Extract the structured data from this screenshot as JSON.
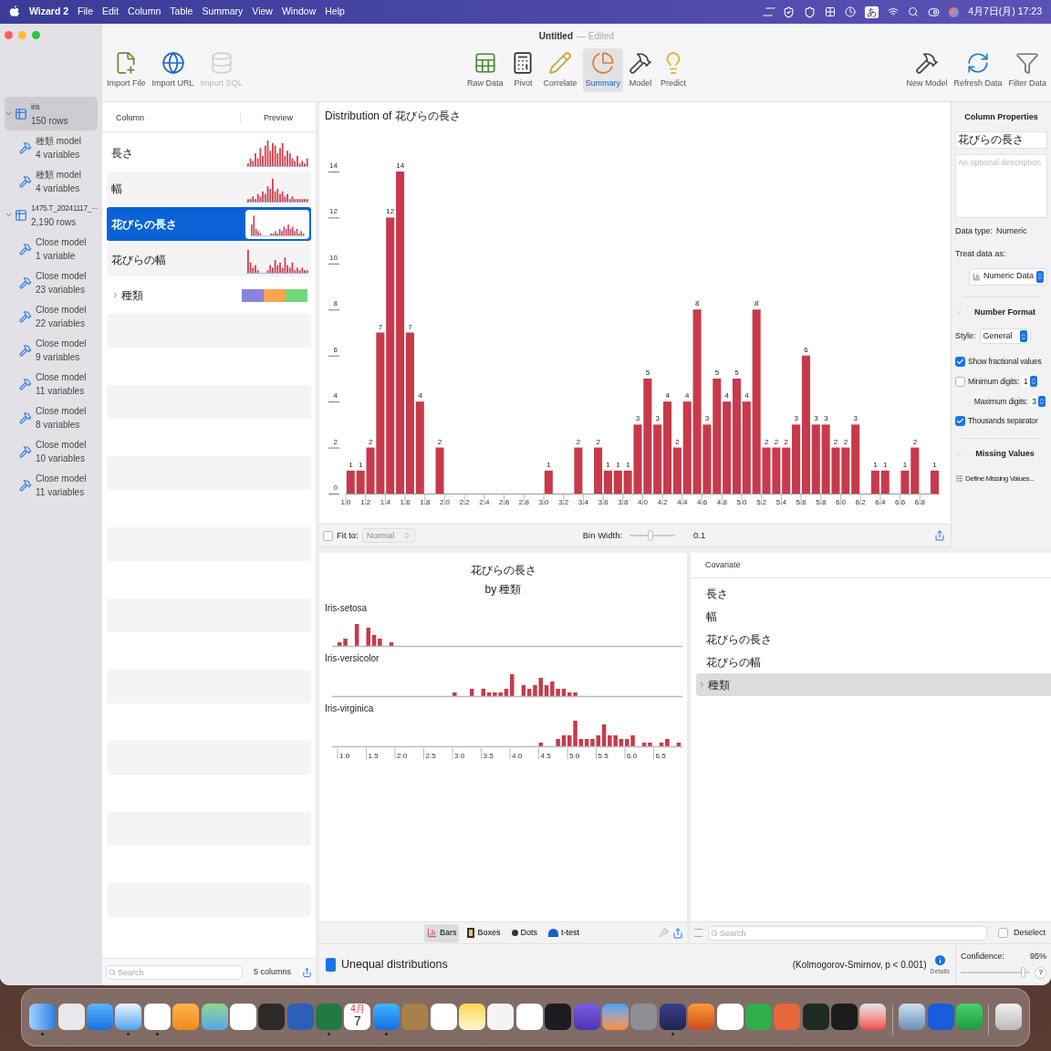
{
  "menu_bar": {
    "app": "Wizard 2",
    "menus": [
      "File",
      "Edit",
      "Column",
      "Table",
      "Summary",
      "View",
      "Window",
      "Help"
    ],
    "input_mode": "あ",
    "clock": "4月7日(月) 17:23"
  },
  "window": {
    "title": "Untitled",
    "status": "— Edited"
  },
  "toolbar": {
    "left": [
      {
        "label": "Import File",
        "kind": "file",
        "disabled": false
      },
      {
        "label": "Import URL",
        "kind": "globe",
        "disabled": false
      },
      {
        "label": "Import SQL",
        "kind": "database",
        "disabled": true
      }
    ],
    "center": [
      {
        "label": "Raw Data",
        "kind": "table",
        "selected": false
      },
      {
        "label": "Pivot",
        "kind": "calculator",
        "selected": false
      },
      {
        "label": "Correlate",
        "kind": "pencil",
        "selected": false
      },
      {
        "label": "Summary",
        "kind": "pie",
        "selected": true
      },
      {
        "label": "Model",
        "kind": "hammer",
        "selected": false
      },
      {
        "label": "Predict",
        "kind": "bulb",
        "selected": false
      }
    ],
    "right": [
      {
        "label": "New Model",
        "kind": "hammer",
        "disabled": false
      },
      {
        "label": "Refresh Data",
        "kind": "refresh",
        "disabled": false
      },
      {
        "label": "Filter Data",
        "kind": "funnel",
        "disabled": false
      }
    ]
  },
  "sidebar": {
    "datasets": [
      {
        "name": "iris",
        "rows": "150 rows",
        "selected": true,
        "expanded": true,
        "children": [
          {
            "name": "種類 model",
            "detail": "4 variables",
            "selected": false
          },
          {
            "name": "種類 model",
            "detail": "4 variables",
            "selected": false
          }
        ]
      },
      {
        "name": "1475.T_20241117_···",
        "rows": "2,190 rows",
        "selected": false,
        "expanded": true,
        "children": [
          {
            "name": "Close model",
            "detail": "1 variable",
            "selected": false
          },
          {
            "name": "Close model",
            "detail": "23 variables",
            "selected": false
          },
          {
            "name": "Close model",
            "detail": "22 variables",
            "selected": false
          },
          {
            "name": "Close model",
            "detail": "9 variables",
            "selected": false
          },
          {
            "name": "Close model",
            "detail": "11 variables",
            "selected": false
          },
          {
            "name": "Close model",
            "detail": "8 variables",
            "selected": false
          },
          {
            "name": "Close model",
            "detail": "10 variables",
            "selected": false
          },
          {
            "name": "Close model",
            "detail": "11 variables",
            "selected": false
          }
        ]
      }
    ]
  },
  "columns": {
    "header": [
      "Column",
      "Preview"
    ],
    "rows": [
      {
        "name": "長さ",
        "kind": "numeric",
        "selected": false
      },
      {
        "name": "幅",
        "kind": "numeric",
        "selected": false
      },
      {
        "name": "花びらの長さ",
        "kind": "numeric",
        "selected": true
      },
      {
        "name": "花びらの幅",
        "kind": "numeric",
        "selected": false
      },
      {
        "name": "種類",
        "kind": "category",
        "selected": false,
        "expanded": false,
        "segments": [
          {
            "color": "#8a83e0"
          },
          {
            "color": "#f7a64e"
          },
          {
            "color": "#72d77a"
          }
        ]
      }
    ],
    "search_placeholder": "Search",
    "count": "5 columns"
  },
  "distribution": {
    "chart_data": {
      "type": "bar",
      "title": "Distribution of 花びらの長さ",
      "x": [
        1.05,
        1.15,
        1.25,
        1.35,
        1.45,
        1.55,
        1.65,
        1.75,
        1.95,
        3.05,
        3.35,
        3.55,
        3.65,
        3.75,
        3.85,
        3.95,
        4.05,
        4.15,
        4.25,
        4.35,
        4.45,
        4.55,
        4.65,
        4.75,
        4.85,
        4.95,
        5.05,
        5.15,
        5.25,
        5.35,
        5.45,
        5.55,
        5.65,
        5.75,
        5.85,
        5.95,
        6.05,
        6.15,
        6.35,
        6.45,
        6.65,
        6.75,
        6.95
      ],
      "xlim": [
        1.0,
        7.0
      ],
      "values": [
        1,
        1,
        2,
        7,
        12,
        14,
        7,
        4,
        2,
        1,
        2,
        2,
        1,
        1,
        1,
        3,
        5,
        3,
        4,
        2,
        4,
        8,
        3,
        5,
        4,
        5,
        4,
        8,
        2,
        2,
        2,
        3,
        6,
        3,
        3,
        2,
        2,
        3,
        1,
        1,
        1,
        2,
        1
      ],
      "xticks": [
        {
          "value": 1.0,
          "label": "1.0"
        },
        {
          "value": 1.2,
          "label": "1.2"
        },
        {
          "value": 1.4,
          "label": "1.4"
        },
        {
          "value": 1.6,
          "label": "1.6"
        },
        {
          "value": 1.8,
          "label": "1.8"
        },
        {
          "value": 2.0,
          "label": "2.0"
        },
        {
          "value": 2.2,
          "label": "2.2"
        },
        {
          "value": 2.4,
          "label": "2.4"
        },
        {
          "value": 2.6,
          "label": "2.6"
        },
        {
          "value": 2.8,
          "label": "2.8"
        },
        {
          "value": 3.0,
          "label": "3.0"
        },
        {
          "value": 3.2,
          "label": "3.2"
        },
        {
          "value": 3.4,
          "label": "3.4"
        },
        {
          "value": 3.6,
          "label": "3.6"
        },
        {
          "value": 3.8,
          "label": "3.8"
        },
        {
          "value": 4.0,
          "label": "4.0"
        },
        {
          "value": 4.2,
          "label": "4.2"
        },
        {
          "value": 4.4,
          "label": "4.4"
        },
        {
          "value": 4.6,
          "label": "4.6"
        },
        {
          "value": 4.8,
          "label": "4.8"
        },
        {
          "value": 5.0,
          "label": "5.0"
        },
        {
          "value": 5.2,
          "label": "5.2"
        },
        {
          "value": 5.4,
          "label": "5.4"
        },
        {
          "value": 5.6,
          "label": "5.6"
        },
        {
          "value": 5.8,
          "label": "5.8"
        },
        {
          "value": 6.0,
          "label": "6.0"
        },
        {
          "value": 6.2,
          "label": "6.2"
        },
        {
          "value": 6.4,
          "label": "6.4"
        },
        {
          "value": 6.6,
          "label": "6.6"
        },
        {
          "value": 6.8,
          "label": "6.8"
        }
      ],
      "yticks": [
        0,
        2,
        4,
        6,
        8,
        10,
        12,
        14
      ],
      "ylim": [
        0,
        14
      ],
      "value_labels": [
        "1",
        "1",
        "2",
        "7",
        "12",
        "14",
        "7",
        "4",
        "2",
        "1",
        "2",
        "2",
        "1",
        "1",
        "1",
        "3",
        "5",
        "3",
        "4",
        "2",
        "4",
        "8",
        "3",
        "5",
        "4",
        "5",
        "4",
        "8",
        "2",
        "2",
        "2",
        "3",
        "6",
        "3",
        "3",
        "2",
        "2",
        "3",
        "1",
        "1",
        "1",
        "2",
        "1"
      ]
    },
    "fit": {
      "label": "Fit to:",
      "checked": false,
      "value": "Normal",
      "disabled": true
    },
    "bin_width": {
      "label": "Bin Width:",
      "level": 0.45,
      "value": "0.1"
    }
  },
  "properties": {
    "title": "Column Properties",
    "name_value": "花びらの長さ",
    "description_placeholder": "An optional description",
    "data_type_label": "Data type:",
    "data_type": "Numeric",
    "treat_label": "Treat data as:",
    "treat_value": "Numeric Data",
    "number_format": {
      "title": "Number Format",
      "expanded": true,
      "style_label": "Style:",
      "style": "General",
      "options": [
        {
          "kind": "checkbox",
          "label": "Show fractional values",
          "checked": true
        },
        {
          "kind": "checked-stepper",
          "label": "Minimum digits:",
          "checked": false,
          "value": "1"
        },
        {
          "kind": "stepper",
          "label": "Maximum digits:",
          "value": "3"
        },
        {
          "kind": "checkbox",
          "label": "Thousands separator",
          "checked": true
        }
      ]
    },
    "missing_values": {
      "title": "Missing Values",
      "expanded": true,
      "action": "Define Missing Values..."
    }
  },
  "group_chart": {
    "title": "花びらの長さ",
    "subtitle": "by 種類",
    "groups": [
      {
        "label": "Iris-setosa"
      },
      {
        "label": "Iris-versicolor"
      },
      {
        "label": "Iris-virginica"
      }
    ],
    "axis_ticks": [
      "1.0",
      "1.5",
      "2.0",
      "2.5",
      "3.0",
      "3.5",
      "4.0",
      "4.5",
      "5.0",
      "5.5",
      "6.0",
      "6.5"
    ]
  },
  "plot_tabs": [
    {
      "label": "Bars",
      "kind": "bars",
      "selected": true
    },
    {
      "label": "Boxes",
      "kind": "boxes",
      "selected": false
    },
    {
      "label": "Dots",
      "kind": "dots",
      "selected": false
    },
    {
      "label": "t-test",
      "kind": "test",
      "selected": false
    }
  ],
  "covariate": {
    "header": "Covariate",
    "items": [
      {
        "name": "長さ",
        "kind": "numeric",
        "selected": false
      },
      {
        "name": "幅",
        "kind": "numeric",
        "selected": false
      },
      {
        "name": "花びらの長さ",
        "kind": "numeric",
        "selected": false
      },
      {
        "name": "花びらの幅",
        "kind": "numeric",
        "selected": false
      },
      {
        "name": "種類",
        "kind": "category",
        "selected": true,
        "expanded": false
      }
    ],
    "search_placeholder": "Search",
    "deselect": {
      "label": "Deselect",
      "checked": false
    }
  },
  "status": {
    "result": "Unequal distributions",
    "test": "(Kolmogorov-Smirnov, p < 0.001)",
    "details": "Details",
    "confidence_label": "Confidence:",
    "confidence_value": "95%",
    "confidence_slider": {
      "level": 0.9
    },
    "help": "?"
  },
  "dock": {
    "items": [
      {
        "kind": "finder",
        "running": true
      },
      {
        "kind": "launchpad",
        "running": false
      },
      {
        "kind": "mail",
        "running": false
      },
      {
        "kind": "safari",
        "running": true
      },
      {
        "kind": "chrome",
        "running": true
      },
      {
        "kind": "pages",
        "running": false
      },
      {
        "kind": "maps",
        "running": false
      },
      {
        "kind": "photos",
        "running": false
      },
      {
        "kind": "clapper",
        "running": false
      },
      {
        "kind": "word",
        "running": false
      },
      {
        "kind": "excel",
        "running": true
      },
      {
        "kind": "calendar",
        "running": false,
        "month": "4月",
        "day": "7"
      },
      {
        "kind": "store",
        "running": true
      },
      {
        "kind": "contacts",
        "running": false
      },
      {
        "kind": "reminders",
        "running": false
      },
      {
        "kind": "notes",
        "running": false
      },
      {
        "kind": "textedit",
        "running": false
      },
      {
        "kind": "player",
        "running": false
      },
      {
        "kind": "dark",
        "running": false
      },
      {
        "kind": "star",
        "running": false
      },
      {
        "kind": "audio",
        "running": false
      },
      {
        "kind": "settings",
        "running": false
      },
      {
        "kind": "plot",
        "running": true
      },
      {
        "kind": "peak",
        "running": false
      },
      {
        "kind": "code",
        "running": false
      },
      {
        "kind": "ring",
        "running": false
      },
      {
        "kind": "burst",
        "running": false
      },
      {
        "kind": "monitor",
        "running": false
      },
      {
        "kind": "terminal",
        "running": false
      },
      {
        "kind": "phone",
        "running": false
      },
      {
        "kind": "separator"
      },
      {
        "kind": "preview",
        "running": false
      },
      {
        "kind": "shield",
        "running": false
      },
      {
        "kind": "numbers",
        "running": false
      },
      {
        "kind": "separator"
      },
      {
        "kind": "trash",
        "running": false
      }
    ]
  }
}
